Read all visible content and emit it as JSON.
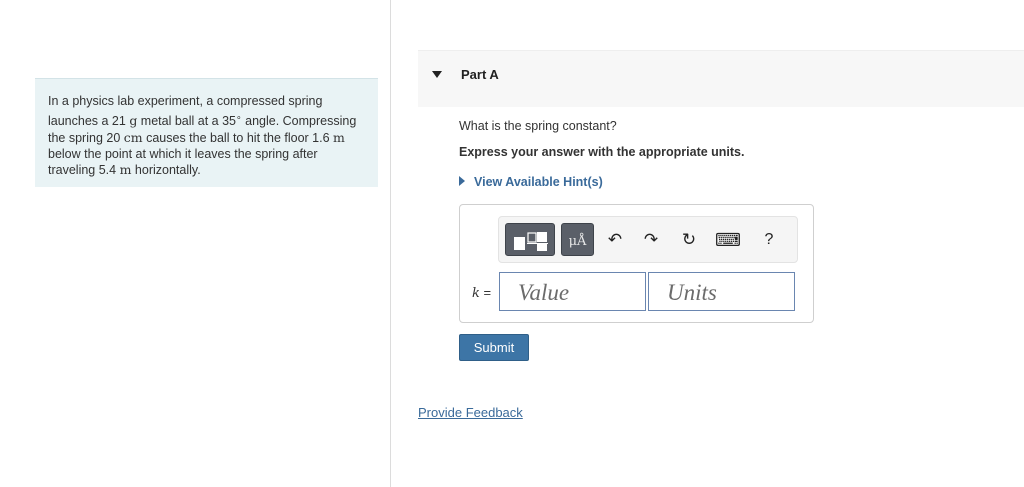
{
  "problem": {
    "seg1": "In a physics lab experiment, a compressed spring launches a 21 ",
    "mass_unit": "g",
    "seg2": " metal ball at a 35",
    "angle_unit": "∘",
    "seg3": " angle. Compressing the spring 20 ",
    "compress_unit": "cm",
    "seg4": " causes the ball to hit the floor 1.6 ",
    "height_unit": "m",
    "seg5": " below the point at which it leaves the spring after traveling 5.4 ",
    "distance_unit": "m",
    "seg6": " horizontally."
  },
  "part": {
    "title": "Part A",
    "question": "What is the spring constant?",
    "instructions": "Express your answer with the appropriate units.",
    "hints_label": "View Available Hint(s)"
  },
  "answer": {
    "variable": "k",
    "equals": " =",
    "value_placeholder": "Value",
    "units_placeholder": "Units"
  },
  "toolbar": {
    "units_button_label": "μÅ",
    "undo_icon": "↶",
    "redo_icon": "↷",
    "reset_icon": "↻",
    "keyboard_icon": "⌨",
    "help_label": "?"
  },
  "buttons": {
    "submit": "Submit",
    "feedback": "Provide Feedback"
  },
  "colors": {
    "accent": "#3d75a6",
    "link": "#3a6a9a",
    "problem_bg": "#e9f3f5"
  }
}
